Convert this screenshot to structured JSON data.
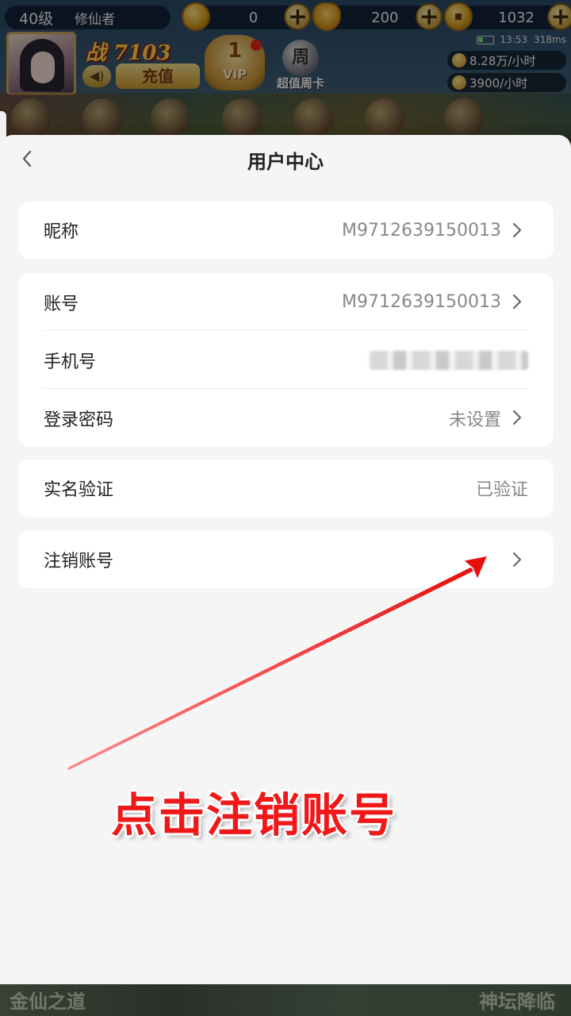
{
  "game_hud": {
    "level": "40级",
    "player_title": "修仙者",
    "currency": [
      {
        "icon": "gold-coin-icon",
        "amount": "0"
      },
      {
        "icon": "gold-ingot-icon",
        "amount": "200"
      },
      {
        "icon": "copper-coin-icon",
        "amount": "1032"
      }
    ],
    "power_text": "战 7103",
    "recharge_label": "充值",
    "vip_level": "1",
    "vip_label": "VIP",
    "weekly_card_label": "超值周卡",
    "clock": "13:53",
    "ping": "318ms",
    "income_rate_1": "8.28万/小时",
    "income_rate_2": "3900/小时",
    "bottom_nav_faded": [
      "金仙之道",
      "神坛降临"
    ]
  },
  "user_center": {
    "title": "用户中心",
    "groups": [
      {
        "rows": [
          {
            "label": "昵称",
            "value": "M9712639150013",
            "arrow": true
          }
        ]
      },
      {
        "rows": [
          {
            "label": "账号",
            "value": "M9712639150013",
            "arrow": true
          },
          {
            "label": "手机号",
            "value": "",
            "blurred": true,
            "arrow": false
          },
          {
            "label": "登录密码",
            "value": "未设置",
            "arrow": true
          }
        ]
      },
      {
        "rows": [
          {
            "label": "实名验证",
            "value": "已验证",
            "arrow": false
          }
        ]
      },
      {
        "rows": [
          {
            "label": "注销账号",
            "value": "",
            "arrow": true
          }
        ]
      }
    ]
  },
  "annotation": {
    "text": "点击注销账号",
    "color": "#f01818"
  }
}
